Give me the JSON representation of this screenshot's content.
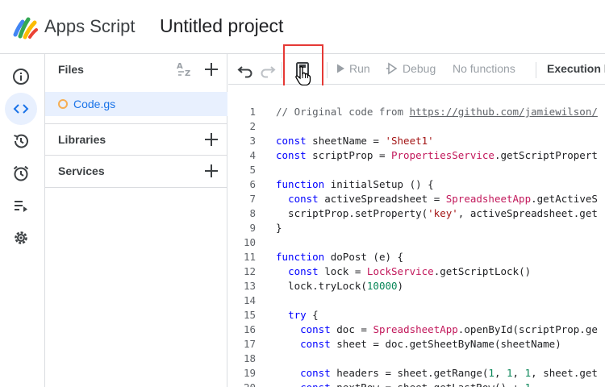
{
  "header": {
    "app_name": "Apps Script",
    "project_title": "Untitled project"
  },
  "rail": {
    "items": [
      {
        "name": "overview",
        "icon": "info-icon"
      },
      {
        "name": "editor",
        "icon": "code-icon",
        "active": true
      },
      {
        "name": "triggers-history",
        "icon": "history-icon"
      },
      {
        "name": "triggers",
        "icon": "alarm-icon"
      },
      {
        "name": "executions",
        "icon": "executions-icon"
      },
      {
        "name": "settings",
        "icon": "gear-icon"
      }
    ]
  },
  "files_panel": {
    "files_label": "Files",
    "files": [
      "Code.gs"
    ],
    "libraries_label": "Libraries",
    "services_label": "Services"
  },
  "toolbar": {
    "run_label": "Run",
    "debug_label": "Debug",
    "functions_label": "No functions",
    "execution_log_label": "Execution l"
  },
  "colors": {
    "accent": "#1a73e8",
    "active_bg": "#e8f0fe",
    "highlight": "#e53935",
    "file_dot": "#f6ae54"
  },
  "editor": {
    "lines": [
      "// Original code from https://github.com/jamiewilson/",
      "",
      "const sheetName = 'Sheet1'",
      "const scriptProp = PropertiesService.getScriptPropert",
      "",
      "function initialSetup () {",
      "  const activeSpreadsheet = SpreadsheetApp.getActiveS",
      "  scriptProp.setProperty('key', activeSpreadsheet.get",
      "}",
      "",
      "function doPost (e) {",
      "  const lock = LockService.getScriptLock()",
      "  lock.tryLock(10000)",
      "",
      "  try {",
      "    const doc = SpreadsheetApp.openById(scriptProp.ge",
      "    const sheet = doc.getSheetByName(sheetName)",
      "",
      "    const headers = sheet.getRange(1, 1, 1, sheet.get",
      "    const nextRow = sheet.getLastRow() + 1"
    ]
  }
}
